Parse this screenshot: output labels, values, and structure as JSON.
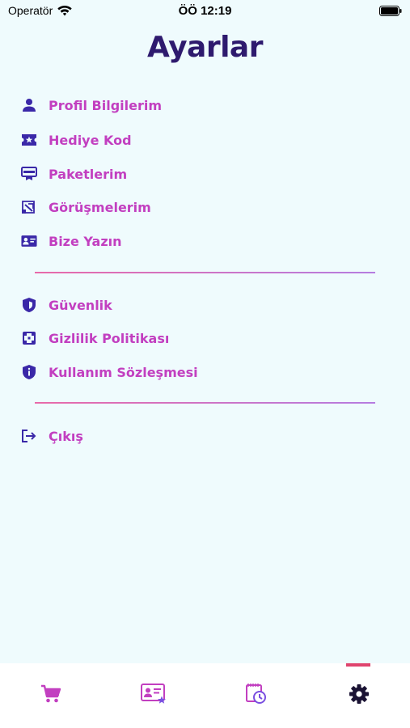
{
  "status_bar": {
    "carrier": "Operatör",
    "time": "ÖÖ 12:19"
  },
  "page": {
    "title": "Ayarlar"
  },
  "menu_group_1": [
    {
      "label": "Profil Bilgilerim",
      "icon": "person-icon"
    },
    {
      "label": "Hediye Kod",
      "icon": "ticket-star-icon"
    },
    {
      "label": "Paketlerim",
      "icon": "card-icon"
    },
    {
      "label": "Görüşmelerim",
      "icon": "call-history-icon"
    },
    {
      "label": "Bize Yazın",
      "icon": "contact-card-icon"
    }
  ],
  "menu_group_2": [
    {
      "label": "Güvenlik",
      "icon": "shield-icon"
    },
    {
      "label": "Gizlilik Politikası",
      "icon": "privacy-icon"
    },
    {
      "label": "Kullanım Sözleşmesi",
      "icon": "info-shield-icon"
    }
  ],
  "menu_group_3": [
    {
      "label": "Çıkış",
      "icon": "logout-icon"
    }
  ],
  "tab_bar": {
    "tabs": [
      {
        "name": "cart",
        "icon": "cart-icon"
      },
      {
        "name": "profile-card",
        "icon": "profile-card-star-icon"
      },
      {
        "name": "history",
        "icon": "calendar-clock-icon"
      },
      {
        "name": "settings",
        "icon": "gear-icon",
        "active": true
      }
    ]
  },
  "colors": {
    "background": "#EFFBFD",
    "title": "#2E1A6E",
    "label": "#C23FC0",
    "icon": "#3A28A8",
    "accent": "#E0446E"
  }
}
